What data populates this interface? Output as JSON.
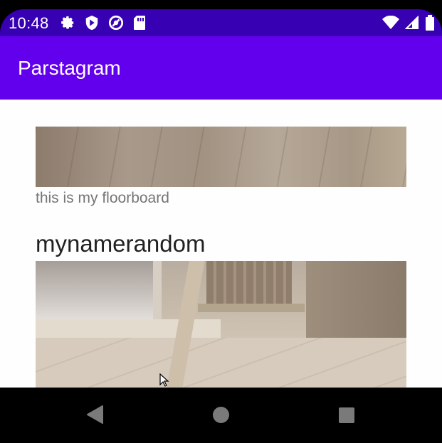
{
  "status_bar": {
    "time": "10:48",
    "left_icons": [
      "settings-icon",
      "shield-play-icon",
      "at-sign-icon",
      "sd-card-icon"
    ],
    "right_icons": [
      "wifi-icon",
      "signal-icon",
      "battery-icon"
    ]
  },
  "app_bar": {
    "title": "Parstagram"
  },
  "feed": {
    "posts": [
      {
        "image": "floorboard photo",
        "caption": "this is my floorboard"
      },
      {
        "username": "mynamerandom",
        "image": "room corner photo with window, ladder shelf and wooden floor"
      }
    ]
  },
  "nav_bar": {
    "buttons": [
      "back-icon",
      "home-icon",
      "recents-icon"
    ]
  },
  "colors": {
    "status_bar": "#3700b3",
    "app_bar": "#6200ee",
    "caption": "#757575",
    "username": "#212121"
  }
}
